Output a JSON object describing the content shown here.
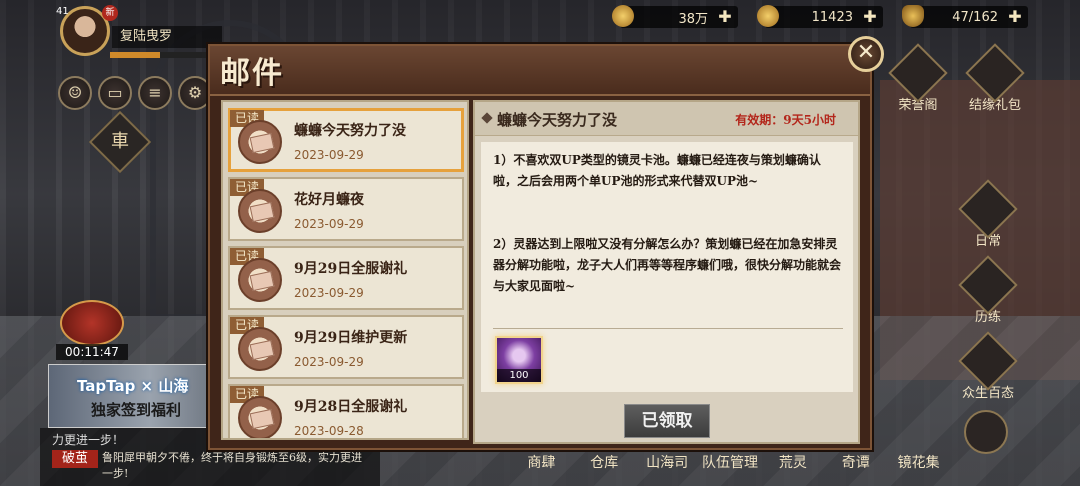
{
  "player": {
    "name": "复陆曳罗",
    "level": "41",
    "new_badge": "新",
    "exp_progress": 0.45
  },
  "resources": [
    {
      "icon": "coin-icon",
      "value": "38万"
    },
    {
      "icon": "gem-icon",
      "value": "11423"
    },
    {
      "icon": "stamina-icon",
      "value": "47/162"
    }
  ],
  "left_menu": {
    "badge_char": "車",
    "timer": "00:11:47"
  },
  "banner": {
    "brand": "TapTap × 山海",
    "subtitle": "独家签到福利"
  },
  "chat": {
    "line0": "力更进一步！",
    "tag": "破茧",
    "message": "鲁阳犀甲朝夕不倦，终于将自身锻炼至6级，实力更进一步!"
  },
  "right_menu": {
    "honor": "荣誉阁",
    "gift": "结缘礼包",
    "daily": "日常",
    "train": "历练",
    "log": "众生百态"
  },
  "bottom_nav": [
    "商肆",
    "仓库",
    "山海司",
    "队伍管理",
    "荒灵",
    "奇谭",
    "镜花集"
  ],
  "mail": {
    "title": "邮件",
    "close": "✕",
    "items": [
      {
        "tag": "已读",
        "title": "蠊蠊今天努力了没",
        "date": "2023-09-29"
      },
      {
        "tag": "已读",
        "title": "花好月蠊夜",
        "date": "2023-09-29"
      },
      {
        "tag": "已读",
        "title": "9月29日全服谢礼",
        "date": "2023-09-29"
      },
      {
        "tag": "已读",
        "title": "9月29日维护更新",
        "date": "2023-09-29"
      },
      {
        "tag": "已读",
        "title": "9月28日全服谢礼",
        "date": "2023-09-28"
      }
    ],
    "detail": {
      "title": "蠊蠊今天努力了没",
      "validity": "有效期：9天5小时",
      "para1": "1）不喜欢双UP类型的镜灵卡池。蠊蠊已经连夜与策划蠊确认啦，之后会用两个单UP池的形式来代替双UP池~",
      "para2": "2）灵器达到上限啦又没有分解怎么办？策划蠊已经在加急安排灵器分解功能啦，龙子大人们再等等程序蠊们哦，很快分解功能就会与大家见面啦~",
      "reward_count": "100",
      "claim_button": "已领取"
    }
  }
}
